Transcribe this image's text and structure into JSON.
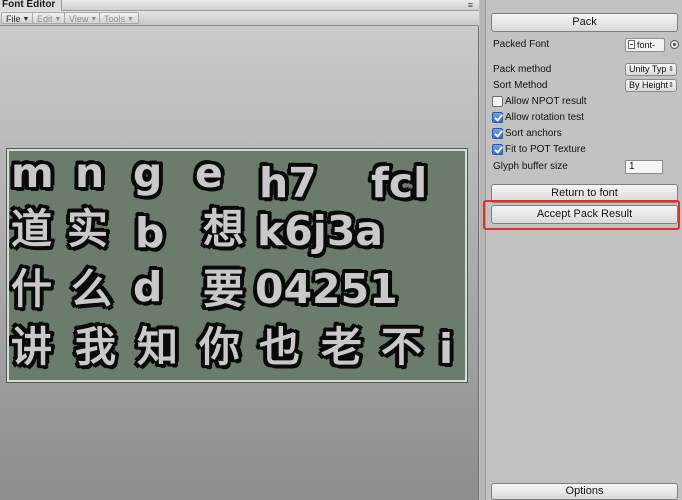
{
  "window": {
    "title": "Font Editor",
    "menu_glyph": "≡"
  },
  "menubar": {
    "items": [
      {
        "label": "File",
        "enabled": true
      },
      {
        "label": "Edit",
        "enabled": false
      },
      {
        "label": "View",
        "enabled": false
      },
      {
        "label": "Tools",
        "enabled": false
      }
    ]
  },
  "atlas": {
    "rows": [
      [
        "m",
        "n",
        "g",
        "e",
        "h7",
        "fcl"
      ],
      [
        "道",
        "实",
        "b",
        "想",
        "k6j3a"
      ],
      [
        "什",
        "么",
        "d",
        "要",
        "04251"
      ],
      [
        "讲",
        "我",
        "知",
        "你",
        "也",
        "老",
        "不",
        "i"
      ]
    ]
  },
  "panel": {
    "pack_button": "Pack",
    "packed_font_label": "Packed Font",
    "packed_font_value": "font-",
    "pack_method_label": "Pack method",
    "pack_method_value": "Unity Typ",
    "sort_method_label": "Sort Method",
    "sort_method_value": "By Height",
    "checkboxes": [
      {
        "label": "Allow NPOT result",
        "checked": false
      },
      {
        "label": "Allow rotation test",
        "checked": true
      },
      {
        "label": "Sort anchors",
        "checked": true
      },
      {
        "label": "Fit to POT Texture",
        "checked": true
      }
    ],
    "glyph_buffer_label": "Glyph buffer size",
    "glyph_buffer_value": "1",
    "return_button": "Return to font",
    "accept_button": "Accept Pack Result",
    "options_button": "Options"
  },
  "colors": {
    "highlight": "#e0302a",
    "checkbox_checked": "#2f6fcf",
    "atlas_background": "#6c7c6c"
  }
}
